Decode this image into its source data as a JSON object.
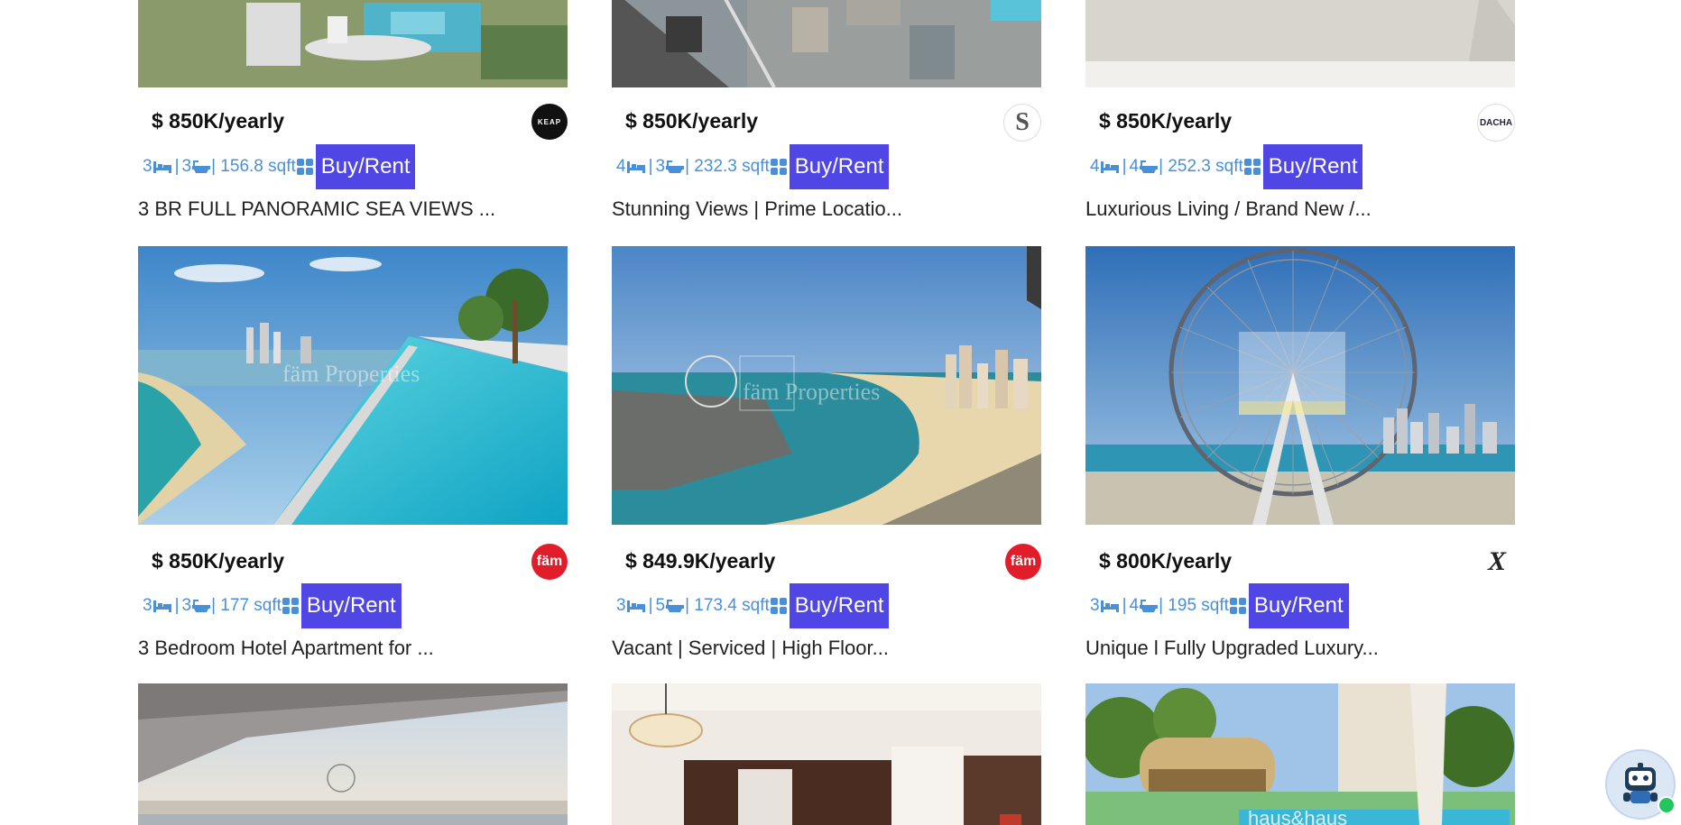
{
  "listings": [
    {
      "price": "$ 850K/yearly",
      "beds": "3",
      "baths": "3",
      "area": "| 156.8 sqft",
      "button": "Buy/Rent",
      "title": "3 BR FULL PANORAMIC SEA VIEWS ...",
      "agency_logo": "keap-logo"
    },
    {
      "price": "$ 850K/yearly",
      "beds": "4",
      "baths": "3",
      "area": "| 232.3 sqft",
      "button": "Buy/Rent",
      "title": "Stunning Views | Prime Locatio...",
      "agency_logo": "s-logo"
    },
    {
      "price": "$ 850K/yearly",
      "beds": "4",
      "baths": "4",
      "area": "| 252.3 sqft",
      "button": "Buy/Rent",
      "title": "Luxurious Living / Brand New /...",
      "agency_logo": "dacha-logo"
    },
    {
      "price": "$ 850K/yearly",
      "beds": "3",
      "baths": "3",
      "area": "| 177 sqft",
      "button": "Buy/Rent",
      "title": "3 Bedroom Hotel Apartment for ...",
      "agency_logo": "fam-logo"
    },
    {
      "price": "$ 849.9K/yearly",
      "beds": "3",
      "baths": "5",
      "area": "| 173.4 sqft",
      "button": "Buy/Rent",
      "title": "Vacant | Serviced | High Floor...",
      "agency_logo": "fam-logo"
    },
    {
      "price": "$ 800K/yearly",
      "beds": "3",
      "baths": "4",
      "area": "| 195 sqft",
      "button": "Buy/Rent",
      "title": "Unique l Fully Upgraded Luxury...",
      "agency_logo": "xi-logo"
    }
  ],
  "logos": {
    "keap": "KEAP",
    "s": "S",
    "dacha": "DACHA",
    "fam": "fäm",
    "xi": "X"
  },
  "watermarks": {
    "fam": "fäm Properties",
    "haus": "haus&haus"
  },
  "colors": {
    "button_bg": "#4f46e5",
    "meta_text": "#4a90d9",
    "fam_red": "#e11d2a"
  }
}
